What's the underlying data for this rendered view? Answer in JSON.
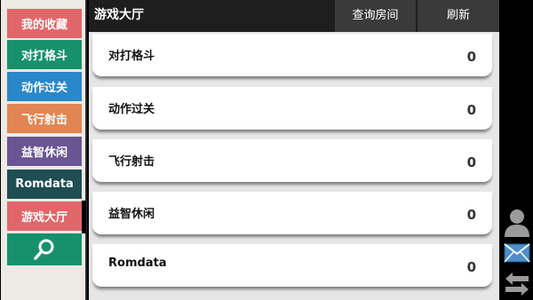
{
  "sidebar": {
    "items": [
      {
        "label": "我的收藏",
        "color": "#e0666a"
      },
      {
        "label": "对打格斗",
        "color": "#17916c"
      },
      {
        "label": "动作过关",
        "color": "#2a87c8"
      },
      {
        "label": "飞行射击",
        "color": "#e08553"
      },
      {
        "label": "益智休闲",
        "color": "#6a5593"
      },
      {
        "label": "Romdata",
        "color": "#1e4d52"
      },
      {
        "label": "游戏大厅",
        "color": "#e0666a"
      }
    ],
    "search_icon": "search-icon"
  },
  "header": {
    "title": "游戏大厅",
    "query_label": "查询房间",
    "refresh_label": "刷新"
  },
  "rows": [
    {
      "name": "对打格斗",
      "count": "0"
    },
    {
      "name": "动作过关",
      "count": "0"
    },
    {
      "name": "飞行射击",
      "count": "0"
    },
    {
      "name": "益智休闲",
      "count": "0"
    },
    {
      "name": "Romdata",
      "count": "0"
    }
  ],
  "right_icons": [
    "user-icon",
    "mail-icon",
    "swap-arrows-icon"
  ]
}
